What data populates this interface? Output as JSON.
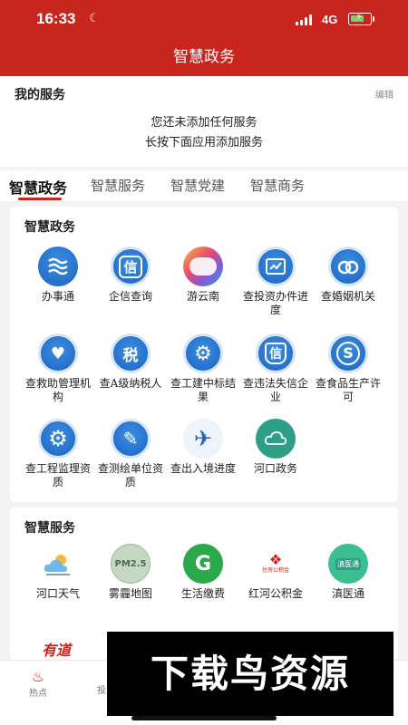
{
  "status": {
    "time": "16:33",
    "network": "4G"
  },
  "header": {
    "title": "智慧政务"
  },
  "my_service": {
    "title": "我的服务",
    "edit_label": "编辑",
    "empty_line1": "您还未添加任何服务",
    "empty_line2": "长按下面应用添加服务"
  },
  "tabs": [
    {
      "label": "智慧政务",
      "active": true
    },
    {
      "label": "智慧服务",
      "active": false
    },
    {
      "label": "智慧党建",
      "active": false
    },
    {
      "label": "智慧商务",
      "active": false
    }
  ],
  "gov_section": {
    "title": "智慧政务",
    "items": [
      {
        "label": "办事通",
        "icon": "wave-icon"
      },
      {
        "label": "企信查询",
        "icon": "credit-icon",
        "glyph": "信"
      },
      {
        "label": "游云南",
        "icon": "cloud-icon"
      },
      {
        "label": "查投资办件进度",
        "icon": "chart-icon"
      },
      {
        "label": "查婚姻机关",
        "icon": "rings-icon"
      },
      {
        "label": "查救助管理机构",
        "icon": "heart-hands-icon"
      },
      {
        "label": "查A级纳税人",
        "icon": "tax-icon",
        "glyph": "税"
      },
      {
        "label": "查工建中标结果",
        "icon": "gear-check-icon"
      },
      {
        "label": "查违法失信企业",
        "icon": "shield-credit-icon",
        "glyph": "信"
      },
      {
        "label": "查食品生产许可",
        "icon": "food-license-icon",
        "glyph": "S"
      },
      {
        "label": "查工程监理资质",
        "icon": "gear-icon"
      },
      {
        "label": "查测绘单位资质",
        "icon": "pencil-ruler-icon"
      },
      {
        "label": "查出入境进度",
        "icon": "airplane-icon"
      },
      {
        "label": "河口政务",
        "icon": "hekou-cloud-icon"
      }
    ]
  },
  "smart_section": {
    "title": "智慧服务",
    "items": [
      {
        "label": "河口天气",
        "icon": "weather-icon"
      },
      {
        "label": "雾霾地图",
        "icon": "haze-map-icon",
        "glyph": "PM2.5"
      },
      {
        "label": "生活缴费",
        "icon": "payment-icon",
        "glyph": "G"
      },
      {
        "label": "红河公积金",
        "icon": "housing-fund-icon",
        "glyph": "住房公积金"
      },
      {
        "label": "滇医通",
        "icon": "medical-icon",
        "glyph": "滇医通"
      }
    ]
  },
  "partial": {
    "youdao_text": "有道"
  },
  "bottom_nav": [
    {
      "label": "热点",
      "icon": "flame-icon"
    },
    {
      "label": "投",
      "icon": ""
    }
  ],
  "watermark": {
    "text": "下载鸟资源"
  },
  "colors": {
    "brand_red": "#c8251f",
    "icon_blue": "#1f63c4",
    "green": "#2aa84a"
  }
}
